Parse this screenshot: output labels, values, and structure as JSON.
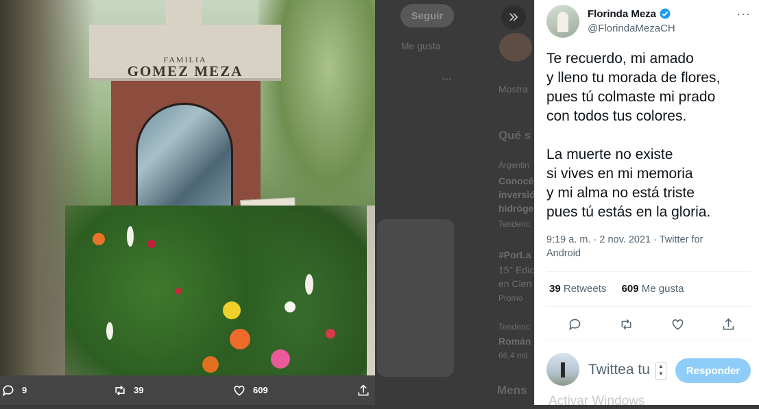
{
  "photo": {
    "tomb_family_small": "FAMILIA",
    "tomb_family_name": "GOMEZ MEZA",
    "bar": {
      "replies": "9",
      "retweets": "39",
      "likes": "609"
    }
  },
  "background": {
    "follow_button": "Seguir",
    "me_gusta": "Me gusta",
    "mostrar": "Mostra",
    "que": "Qué s",
    "argentina": "Argentin",
    "conoce": "Conocé",
    "inversion": "inversió",
    "hidrogen": "hidróge",
    "tendencia1": "Tendenc",
    "porla": "#PorLa",
    "edicion": "15° Edic",
    "en_ciencia": "en Cien",
    "promo": "Promo",
    "tendencia2": "Tendenc",
    "roman": "Román",
    "count": "66,4 mil",
    "mensajes": "Mens"
  },
  "tweet": {
    "author_name": "Florinda Meza",
    "author_handle": "@FlorindaMezaCH",
    "lines": [
      "Te recuerdo, mi amado",
      "y lleno tu morada de flores,",
      "pues tú colmaste mi prado",
      "con todos tus colores.",
      "",
      "La muerte no existe",
      "si vives en mi memoria",
      "y mi alma no está triste",
      "pues tú estás en la gloria."
    ],
    "meta_line1": "9:19 a. m. · 2 nov. 2021 · Twitter for",
    "meta_line2": "Android",
    "retweets_count": "39",
    "retweets_label": "Retweets",
    "likes_count": "609",
    "likes_label": "Me gusta"
  },
  "reply": {
    "placeholder": "Twittea tu",
    "button_label": "Responder"
  },
  "watermark": "Activar Windows",
  "colors": {
    "accent": "#1d9bf0",
    "reply_button_disabled": "#8ecdf8",
    "text_primary": "#0f1419",
    "text_secondary": "#536471"
  }
}
